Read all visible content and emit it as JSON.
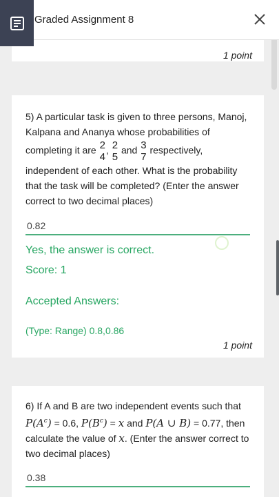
{
  "header": {
    "title": "Graded Assignment 8",
    "icon": "assignment-icon",
    "close_icon": "close-icon"
  },
  "q4_tail": {
    "points": "1 point"
  },
  "q5": {
    "text_a": "5) A particular task is given to three persons, Manoj, Kalpana and Ananya whose probabilities of completing it are",
    "frac1_num": "2",
    "frac1_den": "4",
    "comma": ",",
    "frac2_num": "2",
    "frac2_den": "5",
    "and_word": "and",
    "frac3_num": "3",
    "frac3_den": "7",
    "text_b": "respectively, independent of each other. What is the probability that the task will be completed? (Enter the answer correct to two decimal places)",
    "answer": "0.82",
    "feedback": "Yes, the answer is correct.",
    "score": "Score: 1",
    "accepted_label": "Accepted Answers:",
    "accepted_value": "(Type: Range) 0.8,0.86",
    "points": "1 point"
  },
  "q6": {
    "text_a": "6) If A and B are two independent events such that",
    "m1": "P(A",
    "sup1": "c",
    "m1b": ")",
    "eq1": "= 0.6,",
    "m2": "P(B",
    "sup2": "c",
    "m2b": ")",
    "eq2": "=",
    "m3": "x",
    "and_word": "and",
    "m4": "P(A ∪ B)",
    "eq3": "=",
    "text_b": "0.77, then calculate the value of",
    "m5": "x",
    "text_c": ". (Enter the answer correct to two decimal places)",
    "answer": "0.38"
  },
  "colors": {
    "accent_green": "#27a662",
    "header_icon_bg": "#3c4254"
  }
}
